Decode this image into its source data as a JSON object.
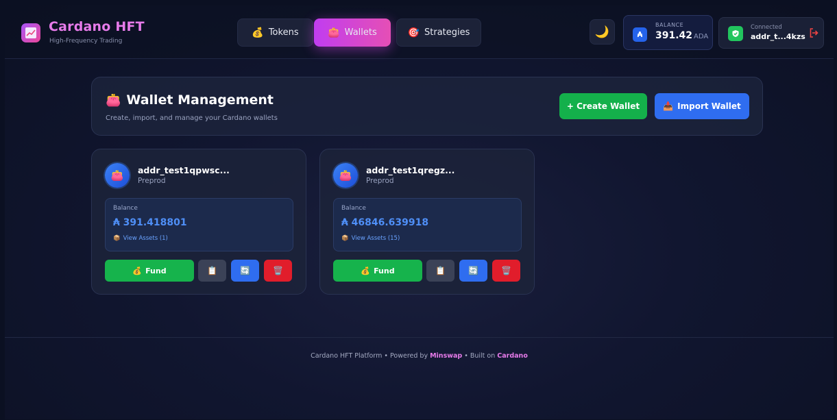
{
  "header": {
    "brand_title": "Cardano HFT",
    "brand_subtitle": "High-Frequency Trading",
    "nav": [
      {
        "label": "Tokens",
        "icon": "money-bag-icon",
        "active": false
      },
      {
        "label": "Wallets",
        "icon": "purse-icon",
        "active": true
      },
      {
        "label": "Strategies",
        "icon": "target-icon",
        "active": false
      }
    ],
    "theme_icon": "moon-icon",
    "balance": {
      "label": "BALANCE",
      "value": "391.42",
      "unit": "ADA",
      "icon_glyph": "₳"
    },
    "connection": {
      "label": "Connected",
      "address": "addr_t...4kzs"
    }
  },
  "management": {
    "title": "Wallet Management",
    "subtitle": "Create, import, and manage your Cardano wallets",
    "create_label": "+ Create Wallet",
    "import_label": "Import Wallet"
  },
  "wallets": [
    {
      "address": "addr_test1qpwsc...",
      "network": "Preprod",
      "balance_label": "Balance",
      "balance": "₳ 391.418801",
      "assets_link": "View Assets (1)",
      "fund_label": "Fund"
    },
    {
      "address": "addr_test1qregz...",
      "network": "Preprod",
      "balance_label": "Balance",
      "balance": "₳ 46846.639918",
      "assets_link": "View Assets (15)",
      "fund_label": "Fund"
    }
  ],
  "footer": {
    "prefix": "Cardano HFT Platform • Powered by ",
    "link1": "Minswap",
    "middle": " • Built on ",
    "link2": "Cardano"
  },
  "colors": {
    "accent_pink": "#e77bea",
    "active_nav": "#c13df0",
    "green": "#16b34c",
    "blue": "#2f6df0",
    "red": "#e11d2b",
    "balance_blue": "#4f8ff7"
  }
}
